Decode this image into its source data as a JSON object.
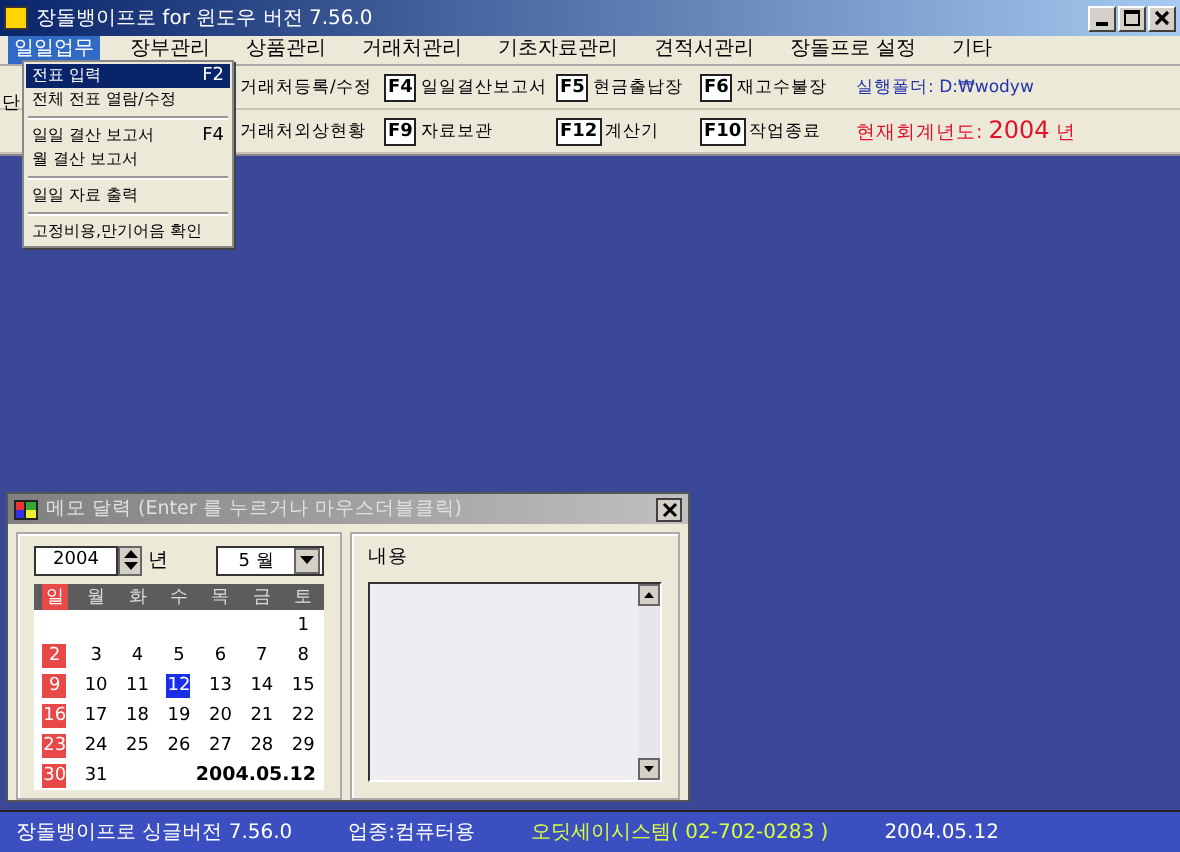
{
  "window": {
    "title": "장돌뱅이프로 for 윈도우 버전 7.56.0"
  },
  "menu": [
    {
      "label": "일일업무",
      "selected": true
    },
    {
      "label": "장부관리",
      "selected": false
    },
    {
      "label": "상품관리",
      "selected": false
    },
    {
      "label": "거래처관리",
      "selected": false
    },
    {
      "label": "기초자료관리",
      "selected": false
    },
    {
      "label": "견적서관리",
      "selected": false
    },
    {
      "label": "장돌프로 설정",
      "selected": false
    },
    {
      "label": "기타",
      "selected": false
    }
  ],
  "toolbar_fragment": "단",
  "toolbar": [
    [
      {
        "label": "거래처등록/수정"
      },
      {
        "key": "F4",
        "label": "일일결산보고서"
      },
      {
        "key": "F5",
        "label": "현금출납장"
      },
      {
        "key": "F6",
        "label": "재고수불장"
      },
      {
        "kind": "info",
        "label": "실행폴더: D:₩wodyw"
      }
    ],
    [
      {
        "label": "거래처외상현황"
      },
      {
        "key": "F9",
        "label": "자료보관"
      },
      {
        "key": "F12",
        "label": "계산기"
      },
      {
        "key": "F10",
        "label": "작업종료"
      },
      {
        "kind": "year",
        "label": "현재회계년도:",
        "value": "2004",
        "unit": "년"
      }
    ]
  ],
  "dropdown": [
    {
      "kind": "item",
      "label": "전표 입력",
      "shortcut": "F2",
      "selected": true
    },
    {
      "kind": "item",
      "label": "전체 전표 열람/수정",
      "selected": false
    },
    {
      "kind": "separator"
    },
    {
      "kind": "item",
      "label": "일일 결산 보고서",
      "shortcut": "F4",
      "selected": false
    },
    {
      "kind": "item",
      "label": "월 결산 보고서",
      "selected": false
    },
    {
      "kind": "separator"
    },
    {
      "kind": "item",
      "label": "일일 자료 출력",
      "selected": false
    },
    {
      "kind": "separator"
    },
    {
      "kind": "item",
      "label": "고정비용,만기어음 확인",
      "selected": false
    }
  ],
  "memo_window": {
    "title": "메모 달력 (Enter 를 누르거나 마우스더블클릭)",
    "year": "2004",
    "year_unit": "년",
    "month": "5 월",
    "weekdays": [
      "일",
      "월",
      "화",
      "수",
      "목",
      "금",
      "토"
    ],
    "weeks": [
      [
        {
          "day": "1",
          "selected": false
        }
      ],
      [
        {
          "day": "2",
          "selected": false
        },
        {
          "day": "3",
          "selected": false
        },
        {
          "day": "4",
          "selected": false
        },
        {
          "day": "5",
          "selected": false
        },
        {
          "day": "6",
          "selected": false
        },
        {
          "day": "7",
          "selected": false
        },
        {
          "day": "8",
          "selected": false
        }
      ],
      [
        {
          "day": "9",
          "selected": false
        },
        {
          "day": "10",
          "selected": false
        },
        {
          "day": "11",
          "selected": false
        },
        {
          "day": "12",
          "selected": true
        },
        {
          "day": "13",
          "selected": false
        },
        {
          "day": "14",
          "selected": false
        },
        {
          "day": "15",
          "selected": false
        }
      ],
      [
        {
          "day": "16",
          "selected": false
        },
        {
          "day": "17",
          "selected": false
        },
        {
          "day": "18",
          "selected": false
        },
        {
          "day": "19",
          "selected": false
        },
        {
          "day": "20",
          "selected": false
        },
        {
          "day": "21",
          "selected": false
        },
        {
          "day": "22",
          "selected": false
        }
      ],
      [
        {
          "day": "23",
          "selected": false
        },
        {
          "day": "24",
          "selected": false
        },
        {
          "day": "25",
          "selected": false
        },
        {
          "day": "26",
          "selected": false
        },
        {
          "day": "27",
          "selected": false
        },
        {
          "day": "28",
          "selected": false
        },
        {
          "day": "29",
          "selected": false
        }
      ],
      [
        {
          "day": "30",
          "selected": false
        },
        {
          "day": "31",
          "selected": false
        }
      ]
    ],
    "date": "2004.05.12",
    "content_label": "내용"
  },
  "status_bar": [
    {
      "kind": "plain",
      "text": "장돌뱅이프로 싱글버전 7.56.0"
    },
    {
      "kind": "plain",
      "text": "업종:컴퓨터용"
    },
    {
      "kind": "highlight",
      "text": "오딧세이시스템( 02-702-0283 )"
    },
    {
      "kind": "plain",
      "text": "2004.05.12"
    }
  ]
}
